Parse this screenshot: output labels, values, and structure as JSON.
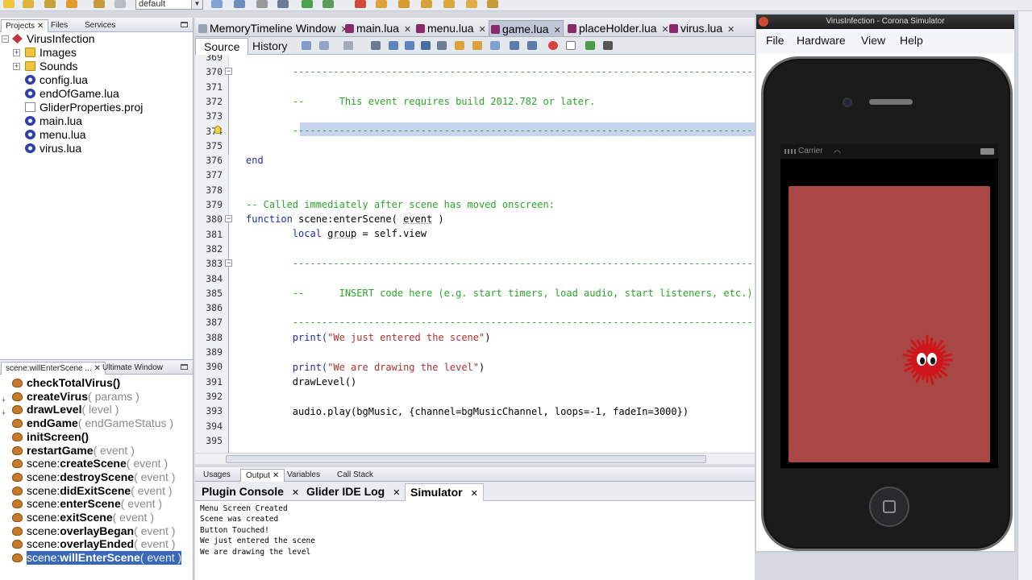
{
  "toolbar": {
    "config_value": "default",
    "icons": [
      "new-file-icon",
      "new-project-icon",
      "open-project-icon",
      "undo-icon",
      "redo-icon",
      "clean-icon",
      "build-icon",
      "debug-icon",
      "profile-icon",
      "run-icon",
      "debug-run-icon",
      "stop-icon",
      "pause-icon",
      "step-over-icon",
      "step-into-icon",
      "step-out-icon",
      "run-cursor-icon",
      "fix-icon"
    ]
  },
  "projects_panel": {
    "tabs": [
      "Projects",
      "Files",
      "Services"
    ],
    "root": "VirusInfection",
    "items": [
      {
        "label": "Images",
        "type": "folder"
      },
      {
        "label": "Sounds",
        "type": "folder"
      },
      {
        "label": "config.lua",
        "type": "lua"
      },
      {
        "label": "endOfGame.lua",
        "type": "lua"
      },
      {
        "label": "GliderProperties.proj",
        "type": "doc"
      },
      {
        "label": "main.lua",
        "type": "lua"
      },
      {
        "label": "menu.lua",
        "type": "lua"
      },
      {
        "label": "virus.lua",
        "type": "lua"
      }
    ]
  },
  "navigator": {
    "tabs": [
      "scene:willEnterScene ...",
      "Ultimate Window"
    ],
    "items": [
      {
        "prefix": "",
        "name": "checkTotalVirus",
        "args": "()",
        "plain_args": true
      },
      {
        "prefix": "",
        "name": "createVirus",
        "args": "( params )",
        "plain_args": false
      },
      {
        "prefix": "",
        "name": "drawLevel",
        "args": "( level )",
        "plain_args": false
      },
      {
        "prefix": "",
        "name": "endGame",
        "args": "( endGameStatus )",
        "plain_args": false
      },
      {
        "prefix": "",
        "name": "initScreen",
        "args": "()",
        "plain_args": true
      },
      {
        "prefix": "",
        "name": "restartGame",
        "args": "( event )",
        "plain_args": false
      },
      {
        "prefix": "scene:",
        "name": "createScene",
        "args": "( event )",
        "plain_args": false
      },
      {
        "prefix": "scene:",
        "name": "destroyScene",
        "args": "( event )",
        "plain_args": false
      },
      {
        "prefix": "scene:",
        "name": "didExitScene",
        "args": "( event )",
        "plain_args": false
      },
      {
        "prefix": "scene:",
        "name": "enterScene",
        "args": "( event )",
        "plain_args": false
      },
      {
        "prefix": "scene:",
        "name": "exitScene",
        "args": "( event )",
        "plain_args": false
      },
      {
        "prefix": "scene:",
        "name": "overlayBegan",
        "args": "( event )",
        "plain_args": false
      },
      {
        "prefix": "scene:",
        "name": "overlayEnded",
        "args": "( event )",
        "plain_args": false
      },
      {
        "prefix": "scene:",
        "name": "willEnterScene",
        "args": "( event )",
        "plain_args": false,
        "selected": true
      }
    ]
  },
  "editor": {
    "tabs": [
      {
        "label": "MemoryTimeline Window",
        "active": false
      },
      {
        "label": "main.lua",
        "active": false
      },
      {
        "label": "menu.lua",
        "active": false
      },
      {
        "label": "game.lua",
        "active": true
      },
      {
        "label": "placeHolder.lua",
        "active": false
      },
      {
        "label": "virus.lua",
        "active": false
      }
    ],
    "source_tab": "Source",
    "history_tab": "History",
    "line_numbers": [
      "369",
      "370",
      "371",
      "372",
      "373",
      "374",
      "375",
      "376",
      "377",
      "378",
      "379",
      "380",
      "381",
      "382",
      "383",
      "384",
      "385",
      "386",
      "387",
      "388",
      "389",
      "390",
      "391",
      "392",
      "393",
      "394",
      "395"
    ],
    "lines": {
      "l370": "        -----------------------------------------------------------------------------------",
      "l372": "        --      This event requires build 2012.782 or later.",
      "l374": "        -----------------------------------------------------------------------------------",
      "l376": "end",
      "l379": "-- Called immediately after scene has moved onscreen:",
      "l380_kw": "function",
      "l380_rest": " scene:enterScene( ",
      "l380_arg": "event",
      "l380_end": " )",
      "l381_kw": "        local",
      "l381_var": "group",
      "l381_rest": " = self.view",
      "l383": "        -----------------------------------------------------------------------------------",
      "l385": "        --      INSERT code here (e.g. start timers, load audio, start listeners, etc.)",
      "l387": "        -----------------------------------------------------------------------------------",
      "l388_fn": "        print(",
      "l388_str": "\"We just entered the scene\"",
      "l388_end": ")",
      "l390_fn": "        print(",
      "l390_str": "\"We are drawing the level\"",
      "l390_end": ")",
      "l391": "        drawLevel()",
      "l393": "        audio.play(bgMusic, {channel=bgMusicChannel, loops=-1, fadeIn=3000})"
    }
  },
  "output": {
    "tabs": [
      "Usages",
      "Output",
      "Variables",
      "Call Stack"
    ],
    "subtabs": [
      "Plugin Console",
      "Glider IDE Log",
      "Simulator"
    ],
    "console_lines": [
      "Menu Screen Created",
      "Scene was created",
      "Button Touched!",
      "We just entered the scene",
      "We are drawing the level"
    ]
  },
  "simulator": {
    "title": "VirusInfection - Corona Simulator",
    "menu": [
      "File",
      "Hardware",
      "View",
      "Help"
    ],
    "carrier": "Carrier",
    "play_color": "#a84743",
    "virus_color": "#d0161c"
  }
}
